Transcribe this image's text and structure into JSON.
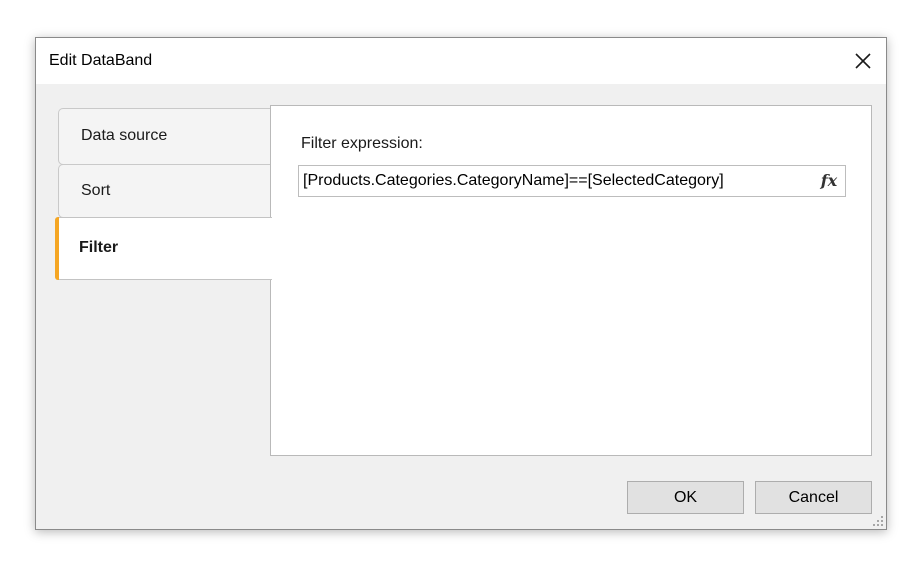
{
  "window": {
    "title": "Edit DataBand",
    "close_icon": "close-icon"
  },
  "tabs": [
    {
      "label": "Data source",
      "selected": false
    },
    {
      "label": "Sort",
      "selected": false
    },
    {
      "label": "Filter",
      "selected": true
    }
  ],
  "filter": {
    "label": "Filter expression:",
    "value": "[Products.Categories.CategoryName]==[SelectedCategory]",
    "function_button_label": "fx"
  },
  "buttons": {
    "ok_label": "OK",
    "cancel_label": "Cancel"
  },
  "colors": {
    "accent": "#f5a623",
    "dialog_background": "#f0f0f0",
    "panel_background": "#ffffff"
  },
  "icons": {
    "close": "close-icon",
    "resize_grip": "resize-grip-icon",
    "function": "function-icon"
  }
}
